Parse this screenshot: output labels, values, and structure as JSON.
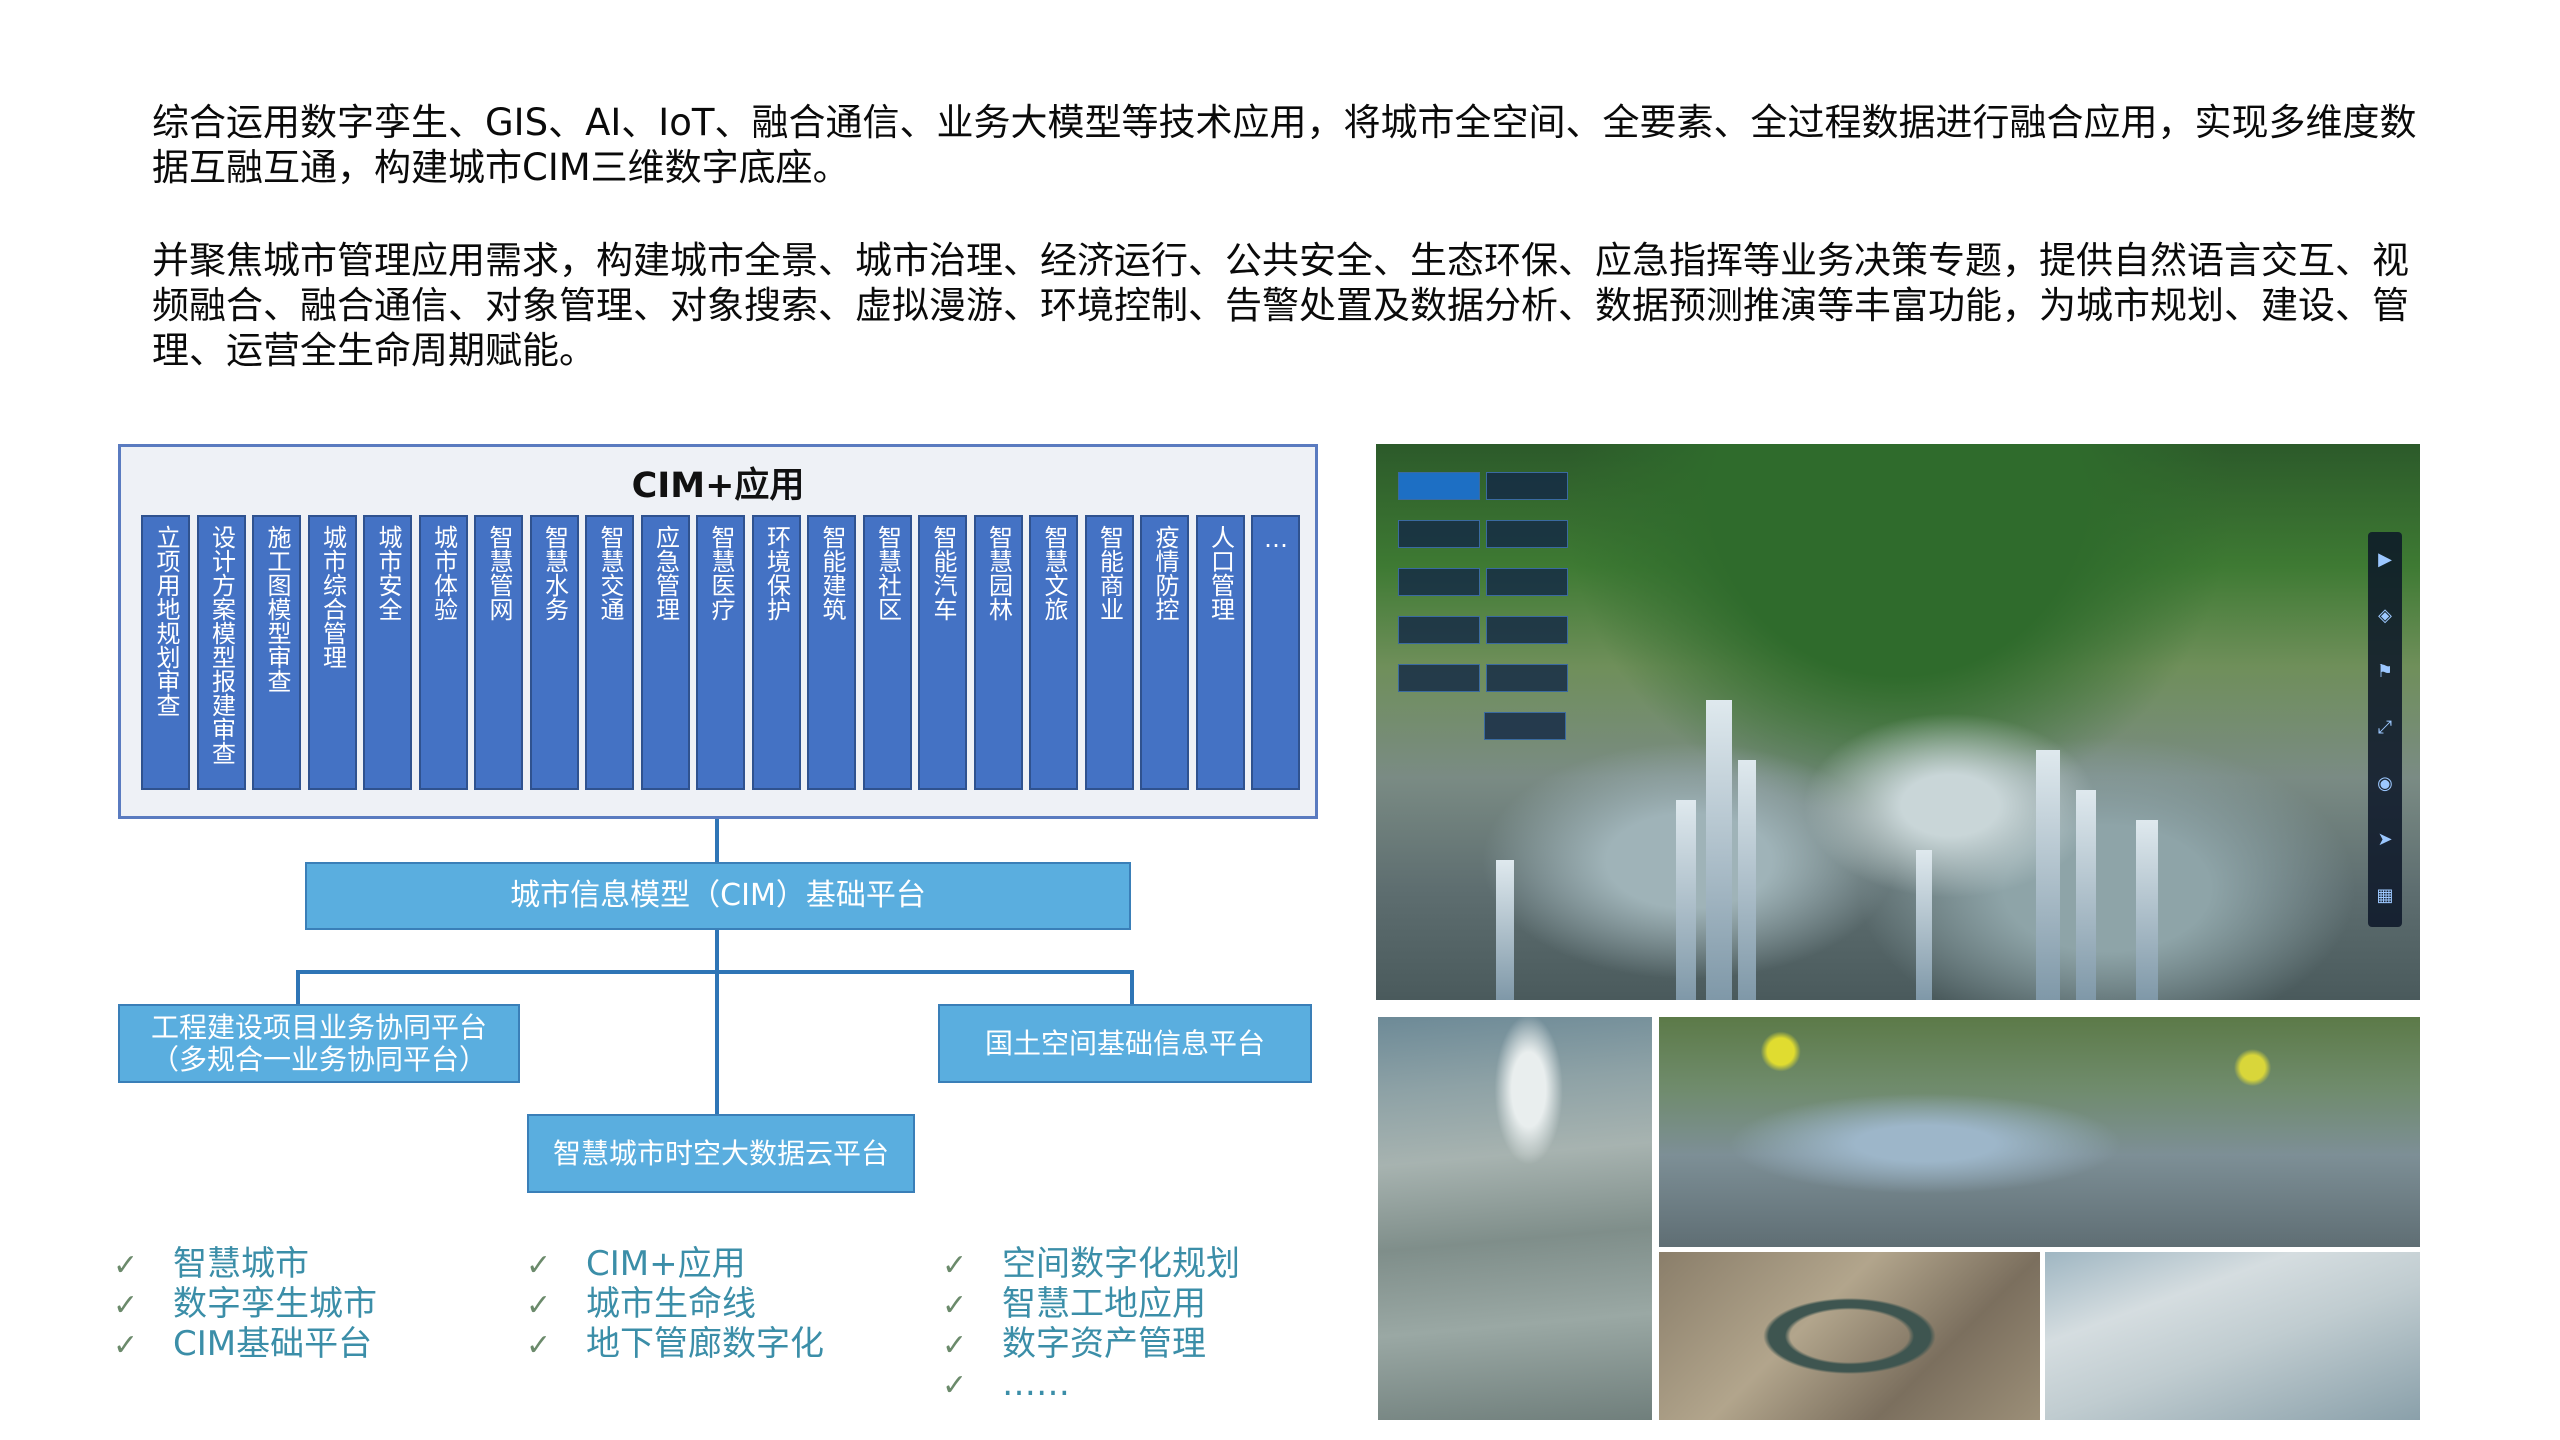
{
  "intro": {
    "p1": "综合运用数字孪生、GIS、AI、IoT、融合通信、业务大模型等技术应用，将城市全空间、全要素、全过程数据进行融合应用，实现多维度数据互融互通，构建城市CIM三维数字底座。",
    "p2": "并聚焦城市管理应用需求，构建城市全景、城市治理、经济运行、公共安全、生态环保、应急指挥等业务决策专题，提供自然语言交互、视频融合、融合通信、对象管理、对象搜索、虚拟漫游、环境控制、告警处置及数据分析、数据预测推演等丰富功能，为城市规划、建设、管理、运营全生命周期赋能。"
  },
  "diagram": {
    "cim_title": "CIM+应用",
    "apps": [
      "立项用地规划审查",
      "设计方案模型报建审查",
      "施工图模型审查",
      "城市综合管理",
      "城市安全",
      "城市体验",
      "智慧管网",
      "智慧水务",
      "智慧交通",
      "应急管理",
      "智慧医疗",
      "环境保护",
      "智能建筑",
      "智慧社区",
      "智能汽车",
      "智慧园林",
      "智慧文旅",
      "智能商业",
      "疫情防控",
      "人口管理",
      "…"
    ],
    "platform_cim": "城市信息模型（CIM）基础平台",
    "platform_eng_line1": "工程建设项目业务协同平台",
    "platform_eng_line2": "（多规合一业务协同平台）",
    "platform_land": "国土空间基础信息平台",
    "platform_cloud": "智慧城市时空大数据云平台",
    "line_color": "#2e75b6",
    "app_color": "#4472c4",
    "platform_color": "#5aaedf"
  },
  "checklists": {
    "col1": [
      "智慧城市",
      "数字孪生城市",
      "CIM基础平台"
    ],
    "col2": [
      "CIM+应用",
      "城市生命线",
      "地下管廊数字化"
    ],
    "col3": [
      "空间数字化规划",
      "智慧工地应用",
      "数字资产管理",
      "……"
    ],
    "check_glyph": "✓",
    "text_color": "#3b8ea8"
  },
  "images": {
    "main_alt": "3D city twin aerial render",
    "icons": [
      "play-icon",
      "layer-icon",
      "flag-icon",
      "expand-icon",
      "location-icon",
      "send-icon",
      "grid-icon"
    ]
  }
}
